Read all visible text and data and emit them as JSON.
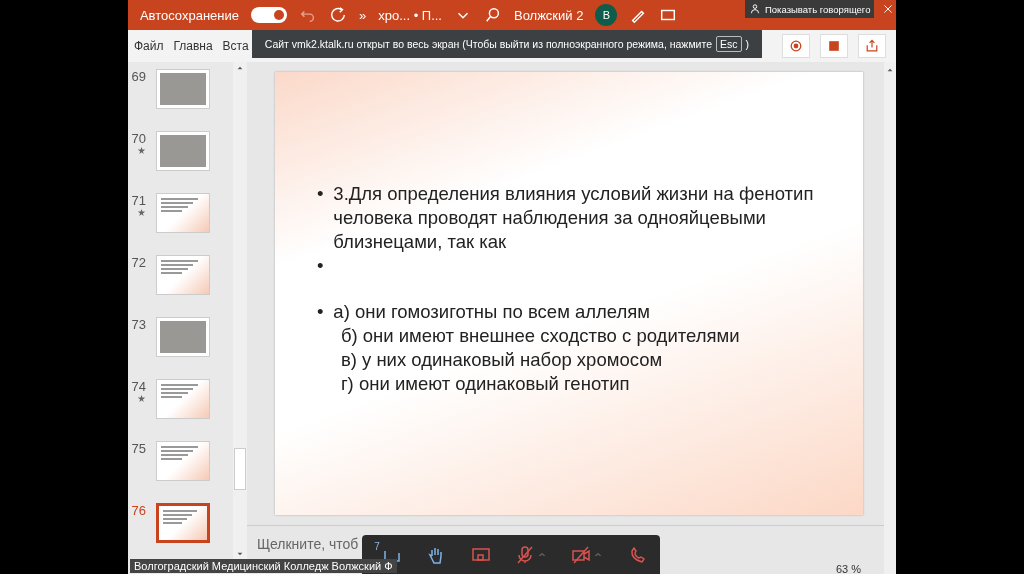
{
  "app_bar": {
    "autosave_label": "Автосохранение",
    "autosave_on": true,
    "overflow": "»",
    "file_name": "хро... • П...",
    "user": "Волжский 2",
    "avatar": "В"
  },
  "speaker_button": {
    "label": "Показывать говорящего"
  },
  "ribbon_tabs": [
    {
      "label": "Файл",
      "selected": false
    },
    {
      "label": "Главна",
      "selected": false
    },
    {
      "label": "Вста",
      "selected": false
    }
  ],
  "fullscreen_notice": {
    "text": "Сайт vmk2.ktalk.ru открыт во весь экран (Чтобы выйти из полноэкранного режима, нажмите",
    "key": "Esc",
    "closing": ")"
  },
  "slides": [
    {
      "number": "69",
      "starred": false,
      "selected": false,
      "kind": "photo"
    },
    {
      "number": "70",
      "starred": true,
      "selected": false,
      "kind": "photo"
    },
    {
      "number": "71",
      "starred": true,
      "selected": false,
      "kind": "text"
    },
    {
      "number": "72",
      "starred": false,
      "selected": false,
      "kind": "text"
    },
    {
      "number": "73",
      "starred": false,
      "selected": false,
      "kind": "photo"
    },
    {
      "number": "74",
      "starred": true,
      "selected": false,
      "kind": "text"
    },
    {
      "number": "75",
      "starred": false,
      "selected": false,
      "kind": "text"
    },
    {
      "number": "76",
      "starred": false,
      "selected": true,
      "kind": "text"
    }
  ],
  "slide": {
    "items": [
      {
        "bullet": "•",
        "text": "3.Для определения влияния условий жизни на фенотип человека проводят наблюдения за однояйцевыми близнецами, так как"
      },
      {
        "bullet": "•"
      },
      {
        "bullet": "•",
        "text": "а) они гомозиготны по всем аллелям"
      },
      {
        "text": "б) они имеют внешнее сходство с родителями"
      },
      {
        "text": "в) у них одинаковый набор хромосом"
      },
      {
        "text": "г) они имеют одинаковый генотип"
      }
    ]
  },
  "notes": {
    "placeholder": "Щелкните, чтоб"
  },
  "status_bar": {
    "zoom": "63 %"
  },
  "caption": "Волгоградский Медицинский Колледж Волжский Ф",
  "call_toolbar": {
    "chat_count": "7",
    "mic_on": false,
    "camera_on": false
  }
}
